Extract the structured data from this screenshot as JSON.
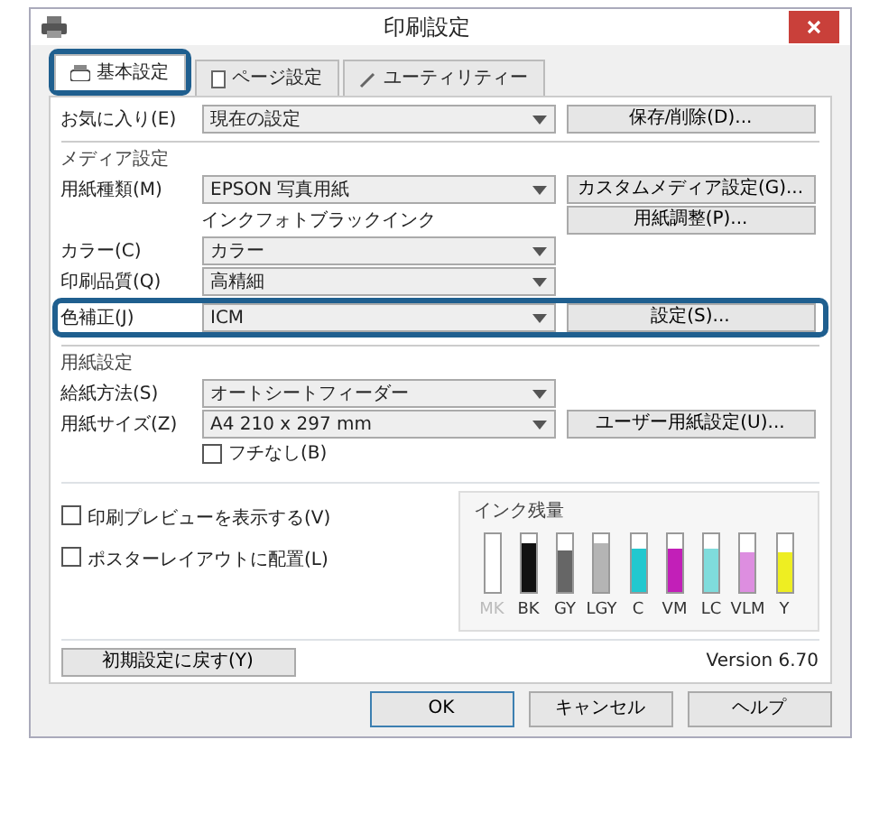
{
  "window": {
    "title": "印刷設定"
  },
  "tabs": [
    {
      "label": "基本設定",
      "selected": true,
      "highlighted": true
    },
    {
      "label": "ページ設定",
      "selected": false,
      "highlighted": false
    },
    {
      "label": "ユーティリティー",
      "selected": false,
      "highlighted": false
    }
  ],
  "favorites": {
    "label": "お気に入り(E)",
    "value": "現在の設定",
    "button": "保存/削除(D)..."
  },
  "media_settings": {
    "title": "メディア設定",
    "rows": [
      {
        "label": "用紙種類(M)",
        "value": "EPSON 写真用紙",
        "button": "カスタムメディア設定(G)...",
        "highlighted": false
      },
      {
        "kind": "note",
        "text": "インクフォトブラックインク",
        "button": "用紙調整(P)..."
      },
      {
        "label": "カラー(C)",
        "value": "カラー",
        "highlighted": false
      },
      {
        "label": "印刷品質(Q)",
        "value": "高精細",
        "highlighted": false
      },
      {
        "label": "色補正(J)",
        "value": "ICM",
        "button": "設定(S)...",
        "highlighted": true
      }
    ]
  },
  "paper_settings": {
    "title": "用紙設定",
    "rows": [
      {
        "label": "給紙方法(S)",
        "value": "オートシートフィーダー",
        "highlighted": false
      },
      {
        "label": "用紙サイズ(Z)",
        "value": "A4 210 x 297 mm",
        "button": "ユーザー用紙設定(U)...",
        "highlighted": false
      }
    ],
    "borderless": {
      "label": "フチなし(B)",
      "checked": false
    }
  },
  "options": [
    {
      "label": "印刷プレビューを表示する(V)",
      "checked": false
    },
    {
      "label": "ポスターレイアウトに配置(L)",
      "checked": false
    }
  ],
  "ink_levels": {
    "title": "インク残量",
    "inks": [
      {
        "name": "MK",
        "level": 0,
        "color": "#ffffff",
        "active": false
      },
      {
        "name": "BK",
        "level": 0.85,
        "color": "#111111",
        "active": true
      },
      {
        "name": "GY",
        "level": 0.72,
        "color": "#666666",
        "active": true
      },
      {
        "name": "LGY",
        "level": 0.85,
        "color": "#b4b4b4",
        "active": true
      },
      {
        "name": "C",
        "level": 0.75,
        "color": "#22c8cf",
        "active": true
      },
      {
        "name": "VM",
        "level": 0.75,
        "color": "#c21fb8",
        "active": true
      },
      {
        "name": "LC",
        "level": 0.75,
        "color": "#7fdcdc",
        "active": true
      },
      {
        "name": "VLM",
        "level": 0.68,
        "color": "#dd8ee0",
        "active": true
      },
      {
        "name": "Y",
        "level": 0.7,
        "color": "#eeee22",
        "active": true
      }
    ]
  },
  "reset_button": "初期設定に戻す(Y)",
  "version": "Version 6.70",
  "buttons": [
    {
      "label": "OK",
      "default": true
    },
    {
      "label": "キャンセル",
      "default": false
    },
    {
      "label": "ヘルプ",
      "default": false
    }
  ]
}
